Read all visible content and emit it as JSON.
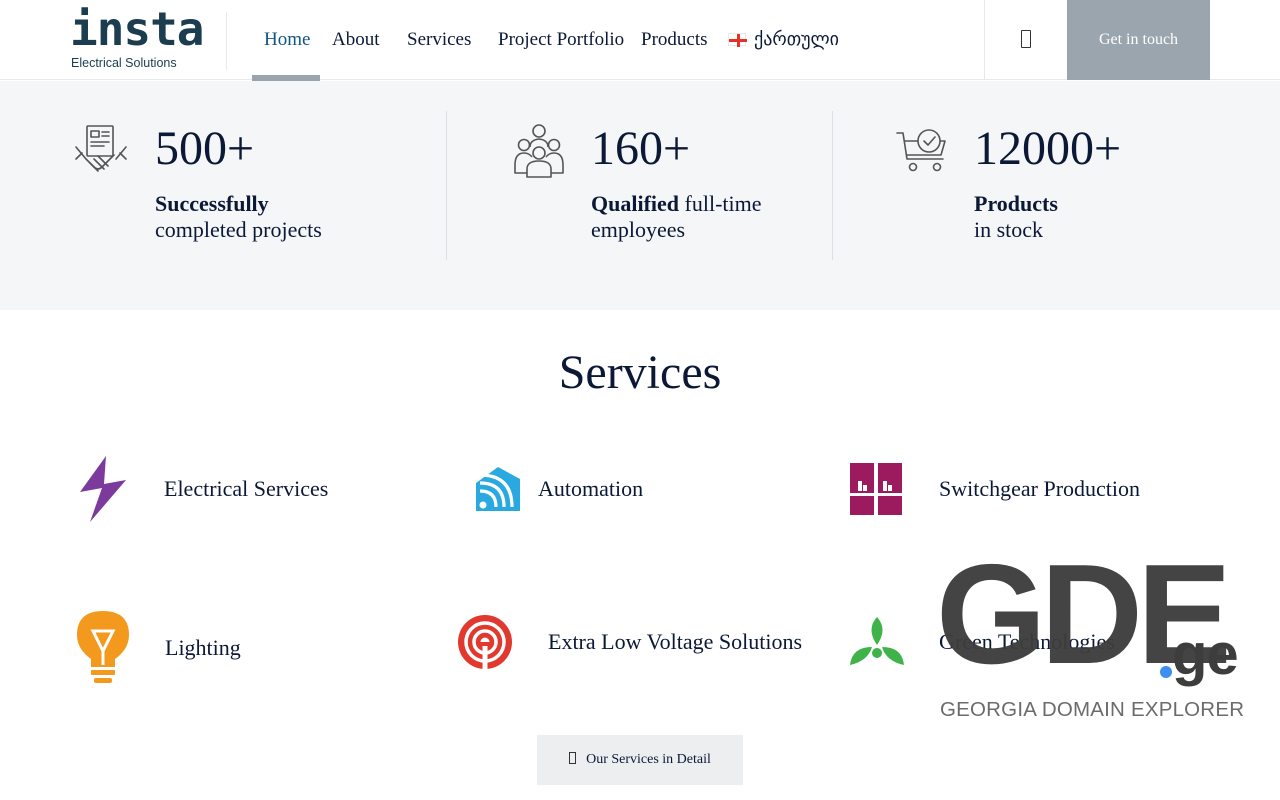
{
  "header": {
    "logo": {
      "word": "insta",
      "subtitle": "Electrical Solutions"
    },
    "nav": [
      {
        "label": "Home",
        "active": true
      },
      {
        "label": "About",
        "active": false
      },
      {
        "label": "Services",
        "active": false
      },
      {
        "label": "Project Portfolio",
        "active": false
      },
      {
        "label": "Products",
        "active": false
      }
    ],
    "language": {
      "label": "ქართული",
      "icon": "georgia-flag-icon"
    },
    "search_icon": "search-icon",
    "cta_label": "Get in touch"
  },
  "stats": [
    {
      "number": "500+",
      "bold": "Successfully",
      "rest": "",
      "line2": "completed projects",
      "icon": "handshake-document-icon"
    },
    {
      "number": "160+",
      "bold": "Qualified",
      "rest": " full-time",
      "line2": "employees",
      "icon": "team-people-icon"
    },
    {
      "number": "12000+",
      "bold": "Products",
      "rest": "",
      "line2": "in stock",
      "icon": "cart-check-icon"
    }
  ],
  "services": {
    "title": "Services",
    "items": [
      {
        "label": "Electrical Services",
        "icon": "lightning-bolt-icon",
        "color": "#7b3a9c"
      },
      {
        "label": "Automation",
        "icon": "wifi-house-icon",
        "color": "#2aa9e0"
      },
      {
        "label": "Switchgear Production",
        "icon": "switchgear-panel-icon",
        "color": "#9c1a5e"
      },
      {
        "label": "Lighting",
        "icon": "light-bulb-icon",
        "color": "#f39a1e"
      },
      {
        "label": "Extra Low Voltage Solutions",
        "icon": "broadcast-signal-icon",
        "color": "#e2392e"
      },
      {
        "label": "Green Technologies",
        "icon": "recycle-leaf-icon",
        "color": "#3fb34a"
      }
    ],
    "detail_button": "Our Services in Detail"
  },
  "watermark": {
    "big": "GDE",
    "ge": "ge",
    "subtitle": "GEORGIA DOMAIN EXPLORER"
  },
  "colors": {
    "primary_text": "#0b1836",
    "active_nav": "#0e5783",
    "cta_bg": "#9ba5ae",
    "stats_bg": "#f4f6f8"
  }
}
